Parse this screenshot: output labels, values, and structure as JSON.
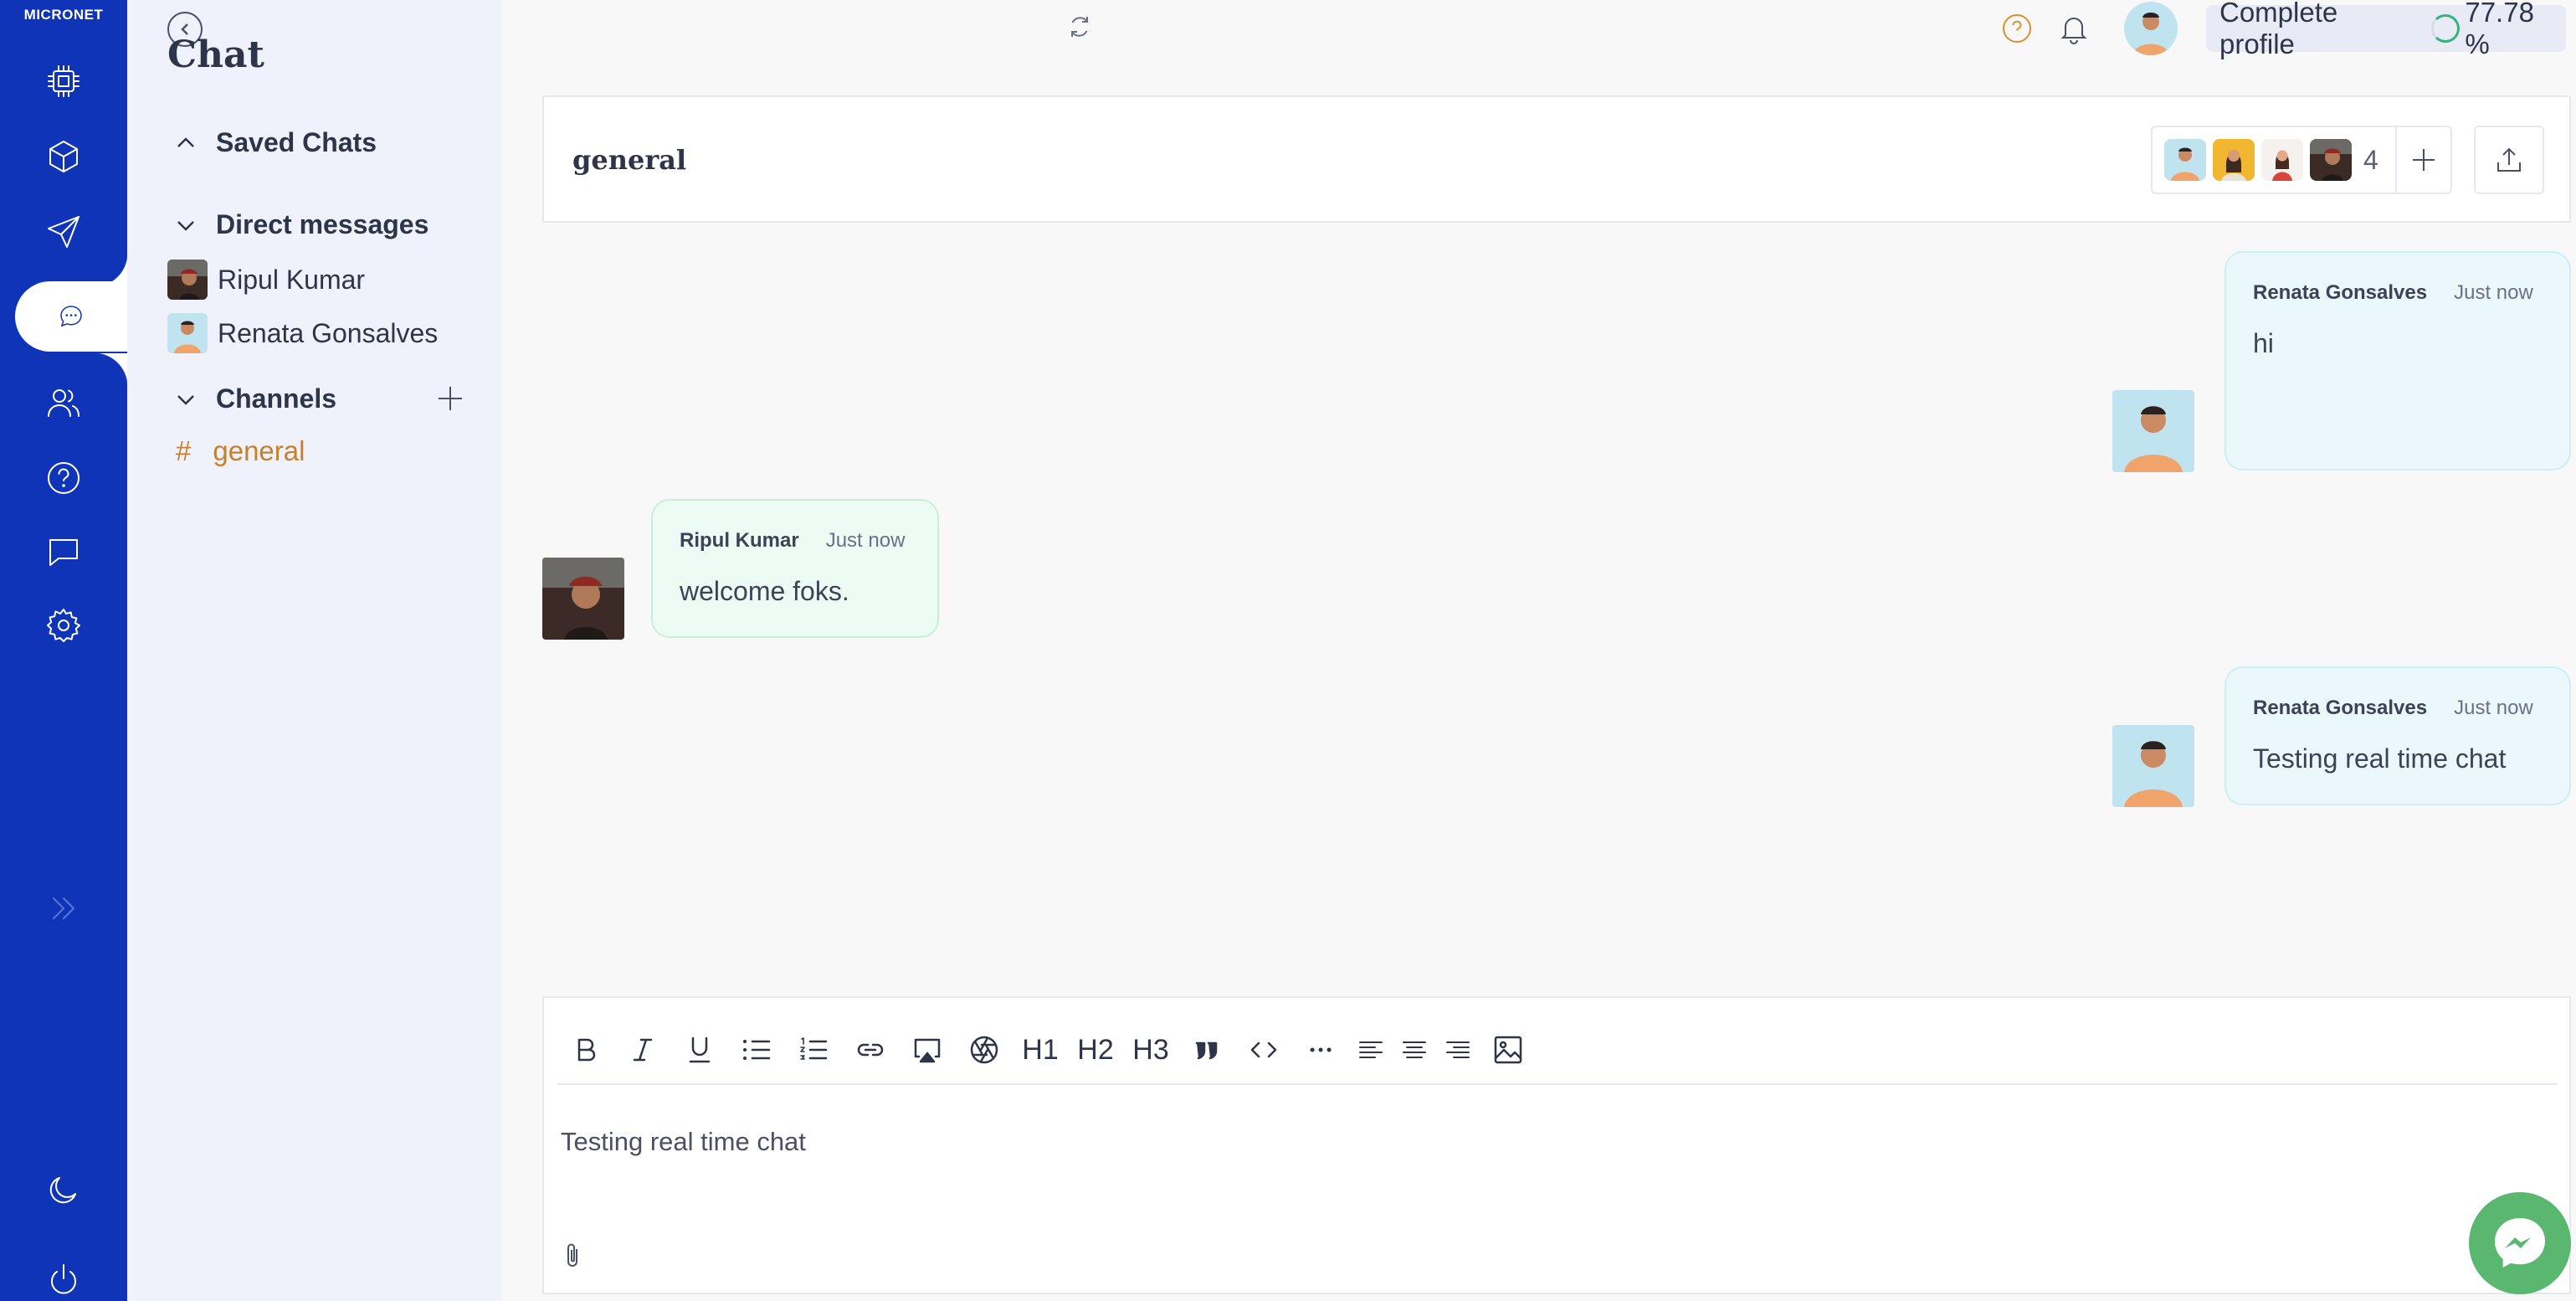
{
  "brand": "MICRONET",
  "sidebar": {
    "title": "Chat",
    "saved_chats_label": "Saved Chats",
    "direct_messages_label": "Direct messages",
    "direct_messages": [
      "Ripul Kumar",
      "Renata Gonsalves"
    ],
    "channels_label": "Channels",
    "channels": [
      {
        "prefix": "#",
        "name": "general"
      }
    ]
  },
  "topbar": {
    "complete_profile_label": "Complete profile",
    "profile_completion": "77.78 %"
  },
  "channel": {
    "name": "general",
    "member_count": "4"
  },
  "messages": [
    {
      "author": "Renata Gonsalves",
      "time": "Just now",
      "text": "hi",
      "side": "right"
    },
    {
      "author": "Ripul Kumar",
      "time": "Just now",
      "text": "welcome foks.",
      "side": "left"
    },
    {
      "author": "Renata Gonsalves",
      "time": "Just now",
      "text": "Testing real time chat",
      "side": "right"
    }
  ],
  "editor": {
    "toolbar": {
      "h1": "H1",
      "h2": "H2",
      "h3": "H3"
    },
    "value": "Testing real time chat"
  },
  "colors": {
    "rail": "#0f34b7",
    "accent_channel": "#c9802a",
    "fab": "#5ab770"
  }
}
